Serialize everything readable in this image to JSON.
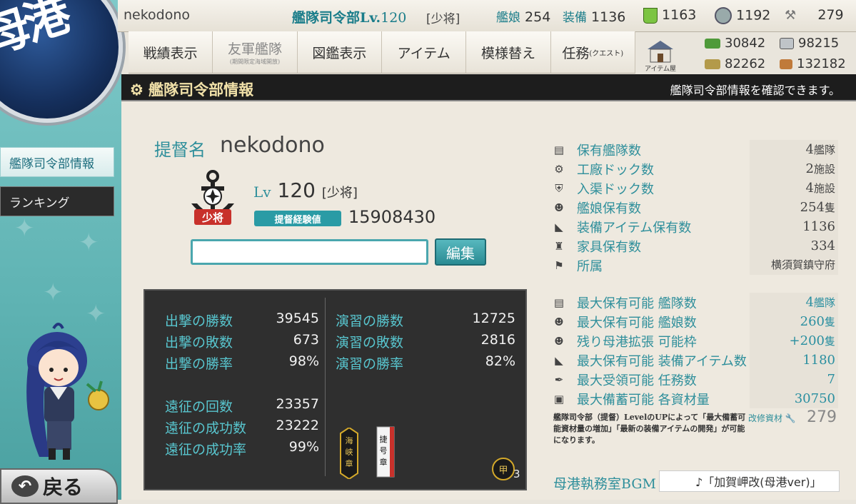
{
  "top": {
    "name": "nekodono",
    "hq_label": "艦隊司令部Lv.",
    "hq_level": "120",
    "rank": "[少将]",
    "shipgirls_label": "艦娘",
    "shipgirls": "254",
    "equipment_label": "装備",
    "equipment": "1136",
    "buckets": "1163",
    "devmats": "1192",
    "screws": "279"
  },
  "nav": {
    "items": [
      {
        "label": "戦績表示",
        "sub": ""
      },
      {
        "label": "友軍艦隊",
        "sub": "(期間限定海域開放)"
      },
      {
        "label": "図鑑表示",
        "sub": ""
      },
      {
        "label": "アイテム",
        "sub": ""
      },
      {
        "label": "模様替え",
        "sub": ""
      },
      {
        "label": "任務",
        "sub": "(クエスト)"
      }
    ],
    "shop_label": "アイテム屋"
  },
  "resources": {
    "fuel": "30842",
    "steel": "98215",
    "ammo": "82262",
    "bauxite": "132182"
  },
  "logo_text": "母港",
  "sidebar": {
    "active_label": "艦隊司令部情報",
    "ranking_label": "ランキング",
    "back_label": "戻る"
  },
  "header": {
    "title": "艦隊司令部情報",
    "description": "艦隊司令部情報を確認できます。"
  },
  "profile": {
    "admiral_label": "提督名",
    "admiral_name": "nekodono",
    "emblem_rank": "少将",
    "lv_label": "Lv",
    "level": "120",
    "rank": "[少将]",
    "xp_label": "提督経験値",
    "xp": "15908430",
    "comment": "",
    "edit_label": "編集"
  },
  "stats": {
    "left": [
      {
        "label": "出撃の勝数",
        "value": "39545"
      },
      {
        "label": "出撃の敗数",
        "value": "673"
      },
      {
        "label": "出撃の勝率",
        "value": "98%"
      },
      {
        "label": "遠征の回数",
        "value": "23357"
      },
      {
        "label": "遠征の成功数",
        "value": "23222"
      },
      {
        "label": "遠征の成功率",
        "value": "99%"
      }
    ],
    "right": [
      {
        "label": "演習の勝数",
        "value": "12725"
      },
      {
        "label": "演習の敗数",
        "value": "2816"
      },
      {
        "label": "演習の勝率",
        "value": "82%"
      }
    ],
    "medal_count": "3",
    "medal_label": "甲",
    "medal_text_1": "海峡章",
    "medal_text_2": "捷号章"
  },
  "info": [
    {
      "icon": "fleet-icon",
      "label": "保有艦隊数",
      "value": "4",
      "unit": "艦隊"
    },
    {
      "icon": "gear-icon",
      "label": "工廠ドック数",
      "value": "2",
      "unit": "施設"
    },
    {
      "icon": "shield-icon",
      "label": "入渠ドック数",
      "value": "4",
      "unit": "施設"
    },
    {
      "icon": "shipgirl-icon",
      "label": "艦娘保有数",
      "value": "254",
      "unit": "隻"
    },
    {
      "icon": "equipment-icon",
      "label": "装備アイテム保有数",
      "value": "1136",
      "unit": ""
    },
    {
      "icon": "chair-icon",
      "label": "家具保有数",
      "value": "334",
      "unit": ""
    },
    {
      "icon": "flag-icon",
      "label": "所属",
      "value": "横須賀鎮守府",
      "unit": ""
    }
  ],
  "limits": [
    {
      "icon": "fleet-icon",
      "label": "最大保有可能 艦隊数",
      "value": "4",
      "unit": "艦隊"
    },
    {
      "icon": "shipgirl-icon",
      "label": "最大保有可能 艦娘数",
      "value": "260",
      "unit": "隻"
    },
    {
      "icon": "shipgirl-icon",
      "label": "残り母港拡張 可能枠",
      "value": "+200",
      "unit": "隻"
    },
    {
      "icon": "equipment-icon",
      "label": "最大保有可能 装備アイテム数",
      "value": "1180",
      "unit": ""
    },
    {
      "icon": "quill-icon",
      "label": "最大受領可能 任務数",
      "value": "7",
      "unit": ""
    },
    {
      "icon": "box-icon",
      "label": "最大備蓄可能 各資材量",
      "value": "30750",
      "unit": ""
    }
  ],
  "note": "艦隊司令部（提督）LevelのUPによって「最大備蓄可能資材量の増加」「最新の装備アイテムの開発」が可能になります。",
  "repair_label": "改修資材",
  "repair_value": "279",
  "bgm_label": "母港執務室BGM",
  "bgm_value": "♪「加賀岬改(母港ver)」"
}
